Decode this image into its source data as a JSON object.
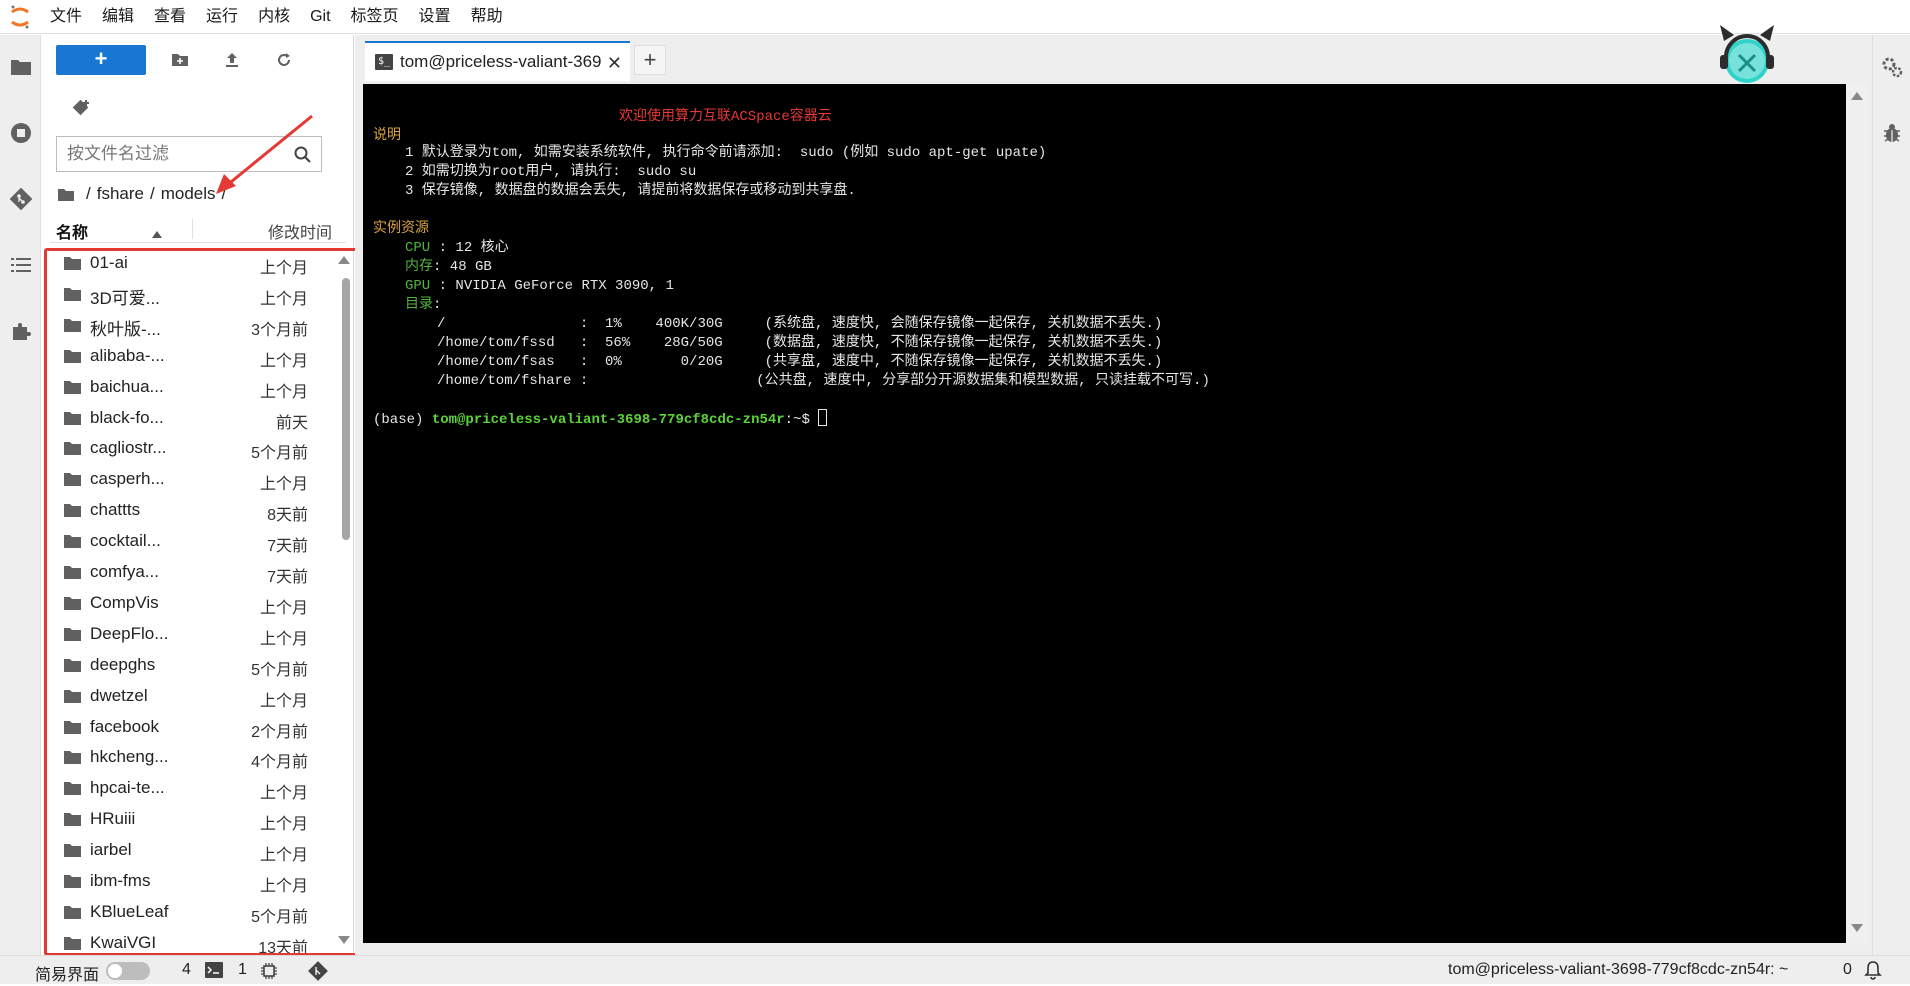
{
  "menubar": {
    "items": [
      "文件",
      "编辑",
      "查看",
      "运行",
      "内核",
      "Git",
      "标签页",
      "设置",
      "帮助"
    ]
  },
  "filebrowser": {
    "new_label": "+",
    "filter_placeholder": "按文件名过滤",
    "breadcrumb": [
      "fshare",
      "models"
    ],
    "col_name": "名称",
    "col_modified": "修改时间",
    "files": [
      {
        "name": "01-ai",
        "modified": "上个月"
      },
      {
        "name": "3D可爱...",
        "modified": "上个月"
      },
      {
        "name": "秋叶版-...",
        "modified": "3个月前"
      },
      {
        "name": "alibaba-...",
        "modified": "上个月"
      },
      {
        "name": "baichua...",
        "modified": "上个月"
      },
      {
        "name": "black-fo...",
        "modified": "前天"
      },
      {
        "name": "cagliostr...",
        "modified": "5个月前"
      },
      {
        "name": "casperh...",
        "modified": "上个月"
      },
      {
        "name": "chattts",
        "modified": "8天前"
      },
      {
        "name": "cocktail...",
        "modified": "7天前"
      },
      {
        "name": "comfya...",
        "modified": "7天前"
      },
      {
        "name": "CompVis",
        "modified": "上个月"
      },
      {
        "name": "DeepFlo...",
        "modified": "上个月"
      },
      {
        "name": "deepghs",
        "modified": "5个月前"
      },
      {
        "name": "dwetzel",
        "modified": "上个月"
      },
      {
        "name": "facebook",
        "modified": "2个月前"
      },
      {
        "name": "hkcheng...",
        "modified": "4个月前"
      },
      {
        "name": "hpcai-te...",
        "modified": "上个月"
      },
      {
        "name": "HRuiii",
        "modified": "上个月"
      },
      {
        "name": "iarbel",
        "modified": "上个月"
      },
      {
        "name": "ibm-fms",
        "modified": "上个月"
      },
      {
        "name": "KBlueLeaf",
        "modified": "5个月前"
      },
      {
        "name": "KwaiVGI",
        "modified": "13天前"
      }
    ]
  },
  "tab": {
    "title": "tom@priceless-valiant-369",
    "close": "✕",
    "add": "+"
  },
  "terminal": {
    "welcome": "欢迎使用算力互联ACSpace容器云",
    "notes_heading": "说明",
    "note1": "1 默认登录为tom, 如需安装系统软件, 执行命令前请添加:  sudo (例如 sudo apt-get upate)",
    "note2": "2 如需切换为root用户, 请执行:  sudo su",
    "note3": "3 保存镜像, 数据盘的数据会丢失, 请提前将数据保存或移动到共享盘.",
    "res_heading": "实例资源",
    "cpu_label": "CPU",
    "cpu_value": " : 12 核心",
    "mem_label": "内存",
    "mem_value": ": 48 GB",
    "gpu_label": "GPU",
    "gpu_value": " : NVIDIA GeForce RTX 3090, 1",
    "dir_label": "目录",
    "dir_colon": ":",
    "dir1": "/                :  1%    400K/30G     (系统盘, 速度快, 会随保存镜像一起保存, 关机数据不丢失.)",
    "dir2": "/home/tom/fssd   :  56%    28G/50G     (数据盘, 速度快, 不随保存镜像一起保存, 关机数据不丢失.)",
    "dir3": "/home/tom/fsas   :  0%       0/20G     (共享盘, 速度中, 不随保存镜像一起保存, 关机数据不丢失.)",
    "dir4": "/home/tom/fshare :                    (公共盘, 速度中, 分享部分开源数据集和模型数据, 只读挂载不可写.)",
    "prompt_env": "(base) ",
    "prompt_user": "tom@priceless-valiant-3698-779cf8cdc-zn54r",
    "prompt_suffix": ":~$ "
  },
  "statusbar": {
    "simple_mode": "简易界面",
    "kernels_count": "4",
    "terminals_count": "1",
    "right_text": "tom@priceless-valiant-3698-779cf8cdc-zn54r: ~",
    "notifications_count": "0"
  },
  "colors": {
    "accent": "#1976d2",
    "highlight": "#e53935",
    "terminal_bg": "#000000"
  }
}
